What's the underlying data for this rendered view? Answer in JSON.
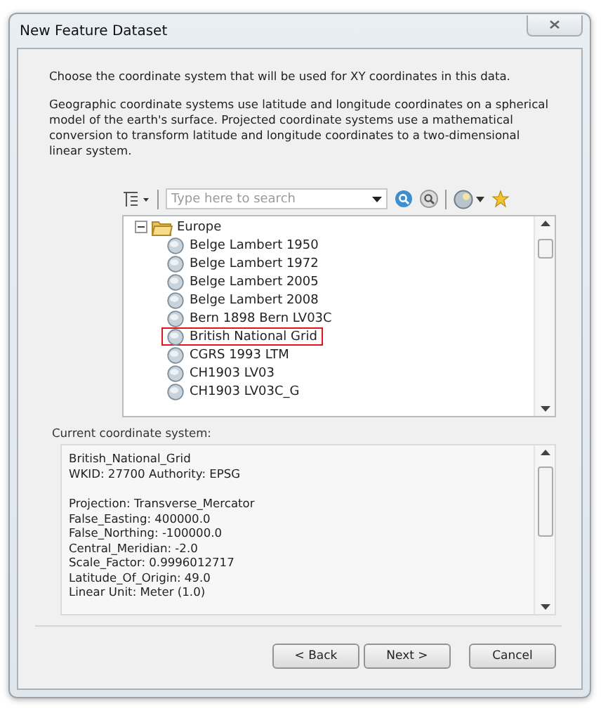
{
  "window": {
    "title": "New Feature Dataset"
  },
  "intro": "Choose the coordinate system that will be used for XY coordinates in this data.",
  "description": "Geographic coordinate systems use latitude and longitude coordinates on a spherical model of the earth's surface. Projected coordinate systems use a mathematical conversion to transform latitude and longitude coordinates to a two-dimensional linear system.",
  "search": {
    "placeholder": "Type here to search"
  },
  "tree": [
    {
      "label": "Europe",
      "expanded": true,
      "children": [
        {
          "label": "Belge Lambert 1950",
          "highlighted": false
        },
        {
          "label": "Belge Lambert 1972",
          "highlighted": false
        },
        {
          "label": "Belge Lambert 2005",
          "highlighted": false
        },
        {
          "label": "Belge Lambert 2008",
          "highlighted": false
        },
        {
          "label": "Bern 1898 Bern LV03C",
          "highlighted": false
        },
        {
          "label": "British National Grid",
          "highlighted": true
        },
        {
          "label": "CGRS 1993 LTM",
          "highlighted": false
        },
        {
          "label": "CH1903 LV03",
          "highlighted": false
        },
        {
          "label": "CH1903 LV03C_G",
          "highlighted": false
        }
      ]
    }
  ],
  "current_label": "Current coordinate system:",
  "current_details": [
    [
      "British_National_Grid",
      "WKID: 27700 Authority: EPSG"
    ],
    [
      "Projection: Transverse_Mercator",
      "False_Easting: 400000.0",
      "False_Northing: -100000.0",
      "Central_Meridian: -2.0",
      "Scale_Factor: 0.9996012717",
      "Latitude_Of_Origin: 49.0",
      "Linear Unit: Meter (1.0)"
    ]
  ],
  "buttons": [
    "< Back",
    "Next >",
    "Cancel"
  ]
}
